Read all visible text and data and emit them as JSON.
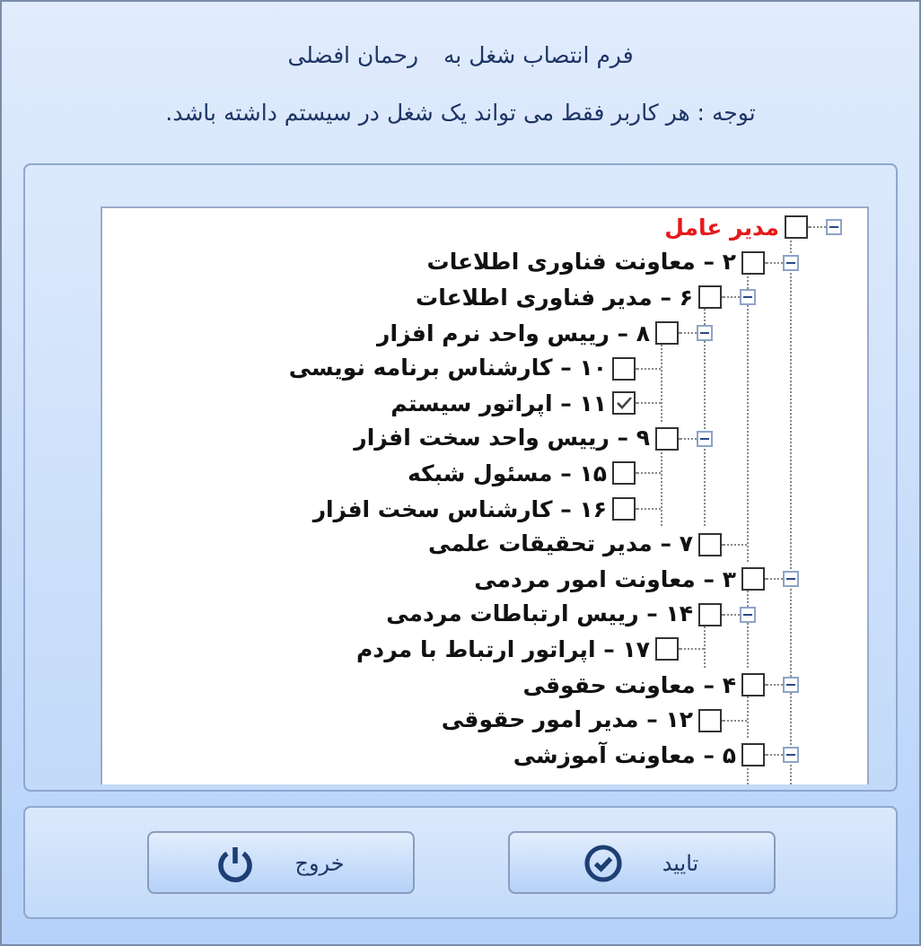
{
  "header": {
    "title": "فرم انتصاب شغل به",
    "user_name": "رحمان افضلی",
    "notice": "توجه : هر کاربر فقط می تواند یک شغل در سیستم داشته باشد."
  },
  "tree": [
    {
      "label": "مدیر عامل",
      "checked": false,
      "expanded": true,
      "children": [
        {
          "label": "۲ – معاونت فناوری اطلاعات",
          "checked": false,
          "expanded": true,
          "children": [
            {
              "label": "۶ – مدیر فناوری اطلاعات",
              "checked": false,
              "expanded": true,
              "children": [
                {
                  "label": "۸ – رییس واحد نرم افزار",
                  "checked": false,
                  "expanded": true,
                  "children": [
                    {
                      "label": "۱۰ – کارشناس برنامه نویسی",
                      "checked": false
                    },
                    {
                      "label": "۱۱ – اپراتور سیستم",
                      "checked": true
                    }
                  ]
                },
                {
                  "label": "۹ – رییس واحد سخت افزار",
                  "checked": false,
                  "expanded": true,
                  "children": [
                    {
                      "label": "۱۵ – مسئول شبکه",
                      "checked": false
                    },
                    {
                      "label": "۱۶ – کارشناس سخت افزار",
                      "checked": false
                    }
                  ]
                }
              ]
            },
            {
              "label": "۷ – مدیر تحقیقات علمی",
              "checked": false
            }
          ]
        },
        {
          "label": "۳ – معاونت امور مردمی",
          "checked": false,
          "expanded": true,
          "children": [
            {
              "label": "۱۴ – رییس ارتباطات مردمی",
              "checked": false,
              "expanded": true,
              "children": [
                {
                  "label": "۱۷ – اپراتور ارتباط با مردم",
                  "checked": false
                }
              ]
            }
          ]
        },
        {
          "label": "۴ – معاونت حقوقی",
          "checked": false,
          "expanded": true,
          "children": [
            {
              "label": "۱۲ – مدیر امور حقوقی",
              "checked": false
            }
          ]
        },
        {
          "label": "۵ – معاونت آموزشی",
          "checked": false,
          "expanded": true
        }
      ]
    }
  ],
  "buttons": [
    {
      "label": "تایید",
      "kind": "confirm"
    },
    {
      "label": "خروج",
      "kind": "exit"
    }
  ]
}
